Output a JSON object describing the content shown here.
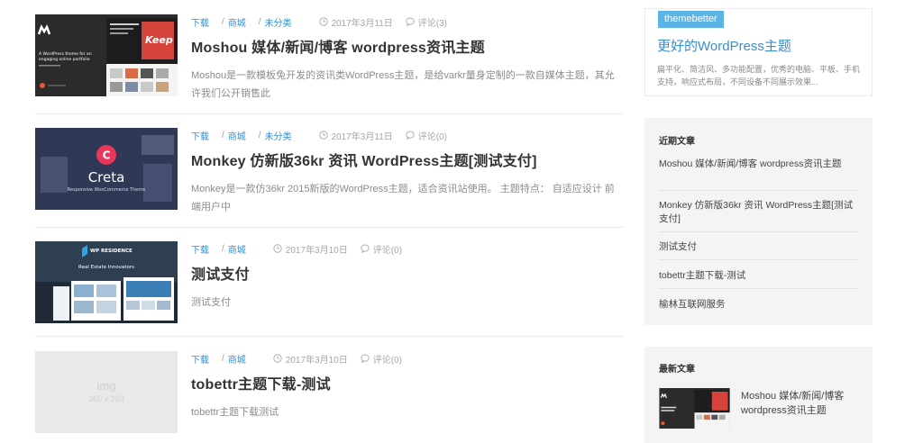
{
  "posts": [
    {
      "cats": [
        "下载",
        "商城",
        "未分类"
      ],
      "date": "2017年3月11日",
      "comments": "评论(3)",
      "title": "Moshou 媒体/新闻/博客 wordpress资讯主题",
      "excerpt": "Moshou是一款模板兔开发的资讯类WordPress主题，是给varkr量身定制的一款自媒体主题，其允许我们公开销售此",
      "thumb_text": [
        "A WordPress theme for an",
        "engaging online portfolio"
      ],
      "thumb_badge": "Keep"
    },
    {
      "cats": [
        "下载",
        "商城",
        "未分类"
      ],
      "date": "2017年3月11日",
      "comments": "评论(0)",
      "title": "Monkey 仿新版36kr 资讯 WordPress主题[测试支付]",
      "excerpt": "Monkey是一款仿36kr 2015新版的WordPress主题，适合资讯站使用。 主题特点： 自适应设计 前端用户中",
      "thumb_letter": "C",
      "thumb_name": "Creta",
      "thumb_sub": "Responsive WooCommerce Theme"
    },
    {
      "cats": [
        "下载",
        "商城"
      ],
      "date": "2017年3月10日",
      "comments": "评论(0)",
      "title": "测试支付",
      "excerpt": "测试支付",
      "thumb_brand": "WP RESIDENCE",
      "thumb_sub": "Real Estate Innovators"
    },
    {
      "cats": [
        "下载",
        "商城"
      ],
      "date": "2017年3月10日",
      "comments": "评论(0)",
      "title": "tobettr主题下载-测试",
      "excerpt": "tobettr主题下载测试",
      "thumb_placeholder": "img",
      "thumb_size": "360 x 203"
    }
  ],
  "sidebar": {
    "promo": {
      "tag": "themebetter",
      "title": "更好的WordPress主题",
      "desc": "扁平化、简洁风、多功能配置，优秀的电脑、平板、手机支持，响应式布局，不同设备不同展示效果..."
    },
    "recent": {
      "title": "近期文章",
      "items": [
        "Moshou 媒体/新闻/博客 wordpress资讯主题",
        "Monkey 仿新版36kr 资讯 WordPress主题[测试支付]",
        "测试支付",
        "tobettr主题下载-测试",
        "榆林互联网服务"
      ]
    },
    "latest": {
      "title": "最新文章",
      "items": [
        "Moshou 媒体/新闻/博客 wordpress资讯主题"
      ]
    }
  },
  "colors": {
    "link": "#3a8ec9",
    "tag_bg": "#5ab4e6",
    "widget_bg": "#f4f4f4"
  }
}
